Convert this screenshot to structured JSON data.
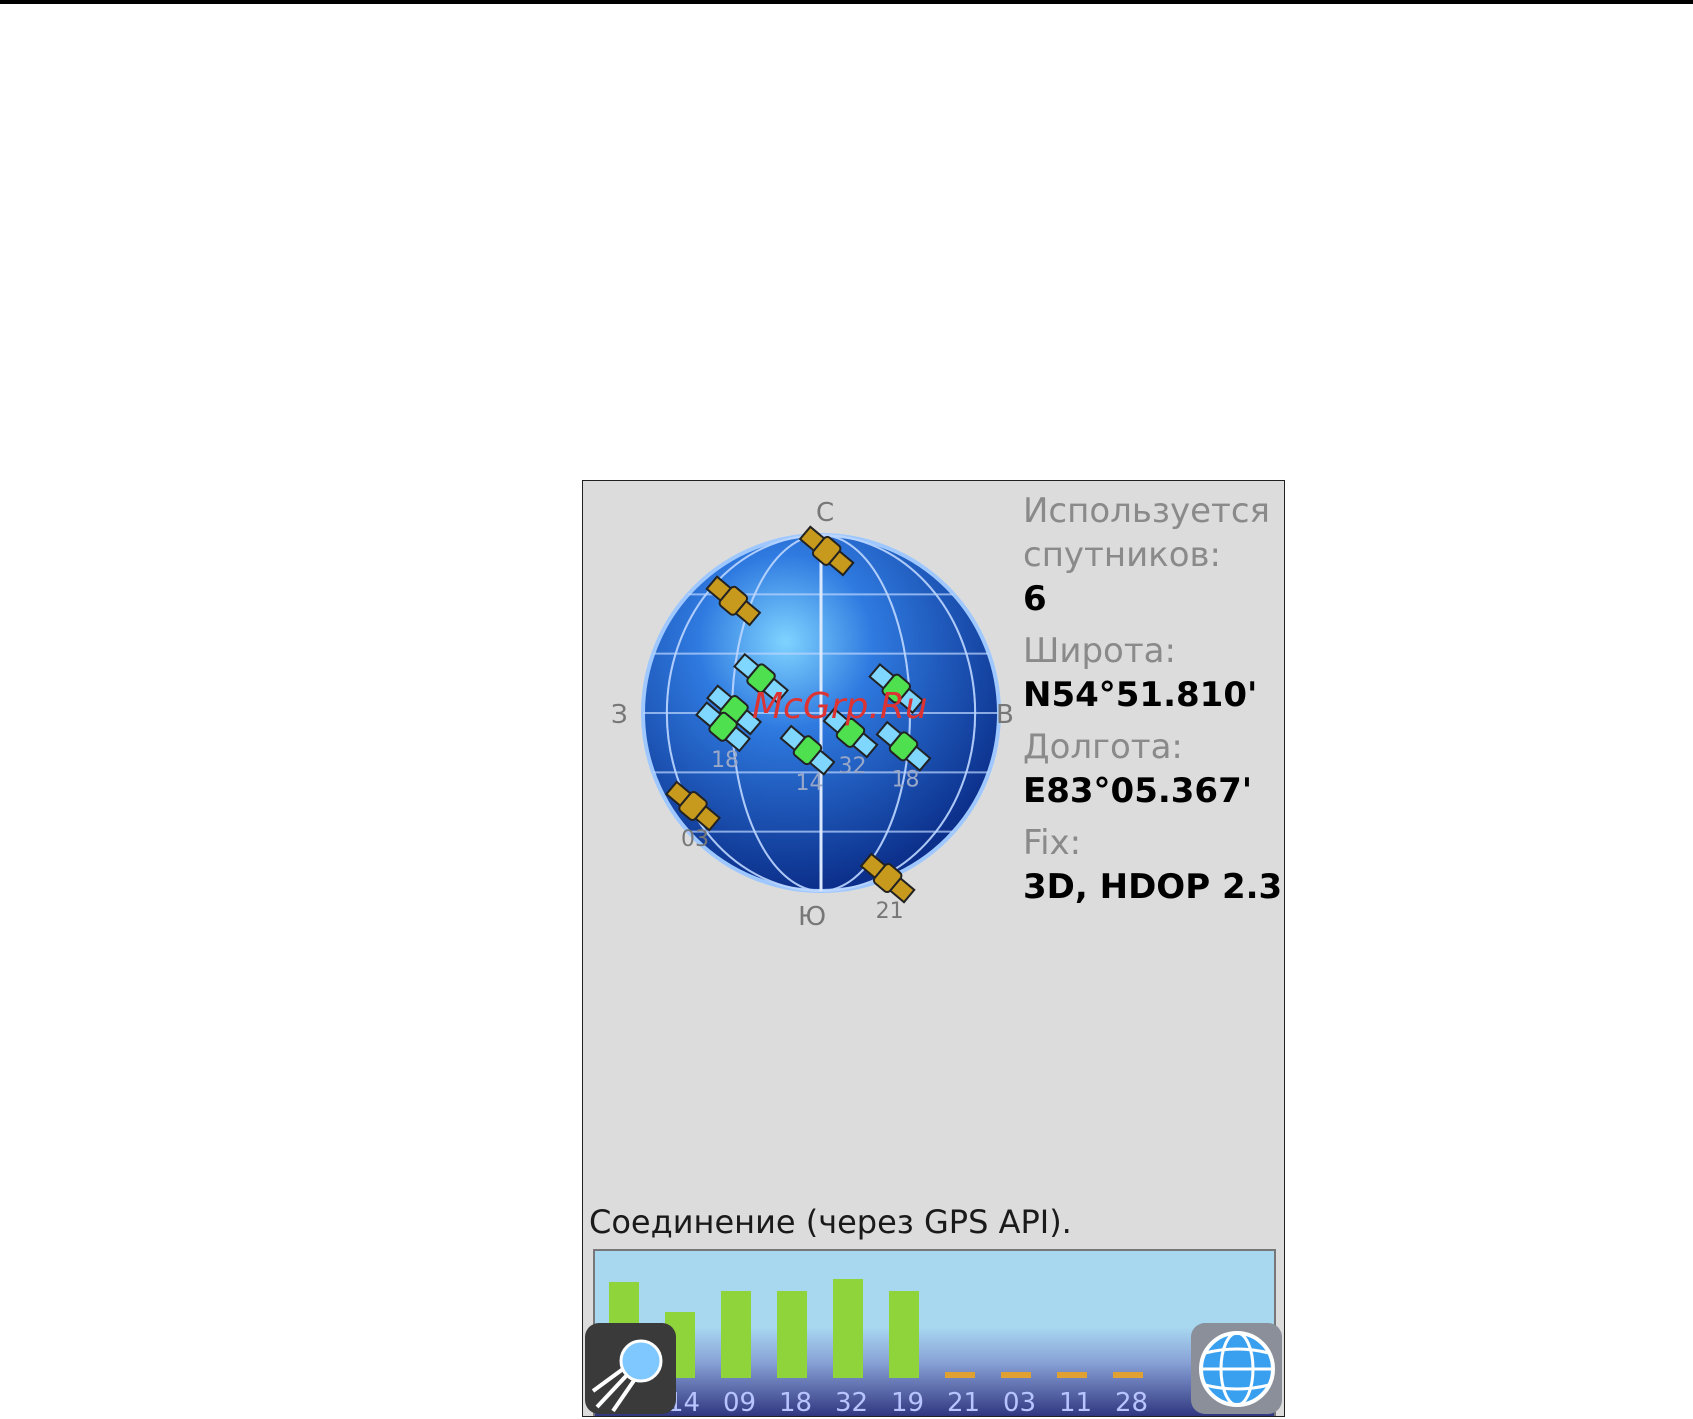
{
  "screen": {
    "info": {
      "sats_used_label_1": "Используется",
      "sats_used_label_2": "спутников:",
      "sats_used_value": "6",
      "lat_label": "Широта:",
      "lat_value": "N54°51.810'",
      "lon_label": "Долгота:",
      "lon_value": "E83°05.367'",
      "fix_label": "Fix:",
      "fix_value": "3D, HDOP 2.3"
    },
    "compass": {
      "north": "С",
      "south": "Ю",
      "west": "З",
      "east": "В"
    },
    "satellites": [
      {
        "id": "",
        "az": 2,
        "el": 8,
        "used": false
      },
      {
        "id": "",
        "az": 322,
        "el": 18,
        "used": false
      },
      {
        "id": "",
        "az": 300,
        "el": 55,
        "used": true
      },
      {
        "id": "",
        "az": 272,
        "el": 46,
        "used": true
      },
      {
        "id": "18",
        "az": 262,
        "el": 40,
        "used": true
      },
      {
        "id": "",
        "az": 72,
        "el": 50,
        "used": true
      },
      {
        "id": "32",
        "az": 124,
        "el": 72,
        "used": true
      },
      {
        "id": "14",
        "az": 200,
        "el": 70,
        "used": true
      },
      {
        "id": "18",
        "az": 112,
        "el": 45,
        "used": true
      },
      {
        "id": "03",
        "az": 234,
        "el": 10,
        "used": false
      },
      {
        "id": "21",
        "az": 158,
        "el": 0,
        "used": false
      }
    ],
    "status_text": "Соединение (через GPS API).",
    "signals": [
      {
        "id": "",
        "value": 0.64,
        "used": true
      },
      {
        "id": "14",
        "value": 0.44,
        "used": true
      },
      {
        "id": "09",
        "value": 0.58,
        "used": true
      },
      {
        "id": "18",
        "value": 0.58,
        "used": true
      },
      {
        "id": "32",
        "value": 0.66,
        "used": true
      },
      {
        "id": "19",
        "value": 0.58,
        "used": true
      },
      {
        "id": "21",
        "value": 0.0,
        "used": false
      },
      {
        "id": "03",
        "value": 0.0,
        "used": false
      },
      {
        "id": "11",
        "value": 0.0,
        "used": false
      },
      {
        "id": "28",
        "value": 0.0,
        "used": false
      }
    ],
    "colors": {
      "used": "#4ee04e",
      "unused": "#c79a1e",
      "bar": "#8fd43a",
      "bar_unused": "#e0a032",
      "globe": "#1a4fbf"
    },
    "watermark": "McGrp.Ru"
  }
}
